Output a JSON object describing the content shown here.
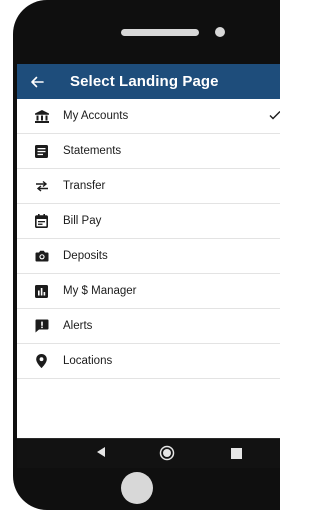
{
  "header": {
    "title": "Select Landing Page",
    "back_icon": "arrow-left-icon"
  },
  "menu": {
    "items": [
      {
        "label": "My Accounts",
        "icon": "bank-icon",
        "selected": true
      },
      {
        "label": "Statements",
        "icon": "document-lines-icon",
        "selected": false
      },
      {
        "label": "Transfer",
        "icon": "swap-arrows-icon",
        "selected": false
      },
      {
        "label": "Bill Pay",
        "icon": "calendar-icon",
        "selected": false
      },
      {
        "label": "Deposits",
        "icon": "camera-icon",
        "selected": false
      },
      {
        "label": "My $ Manager",
        "icon": "bar-chart-icon",
        "selected": false
      },
      {
        "label": "Alerts",
        "icon": "alert-message-icon",
        "selected": false
      },
      {
        "label": "Locations",
        "icon": "location-pin-icon",
        "selected": false
      }
    ]
  },
  "colors": {
    "appbar": "#1e4d7b",
    "text": "#1c1c1c",
    "device": "#0f0f0f"
  }
}
